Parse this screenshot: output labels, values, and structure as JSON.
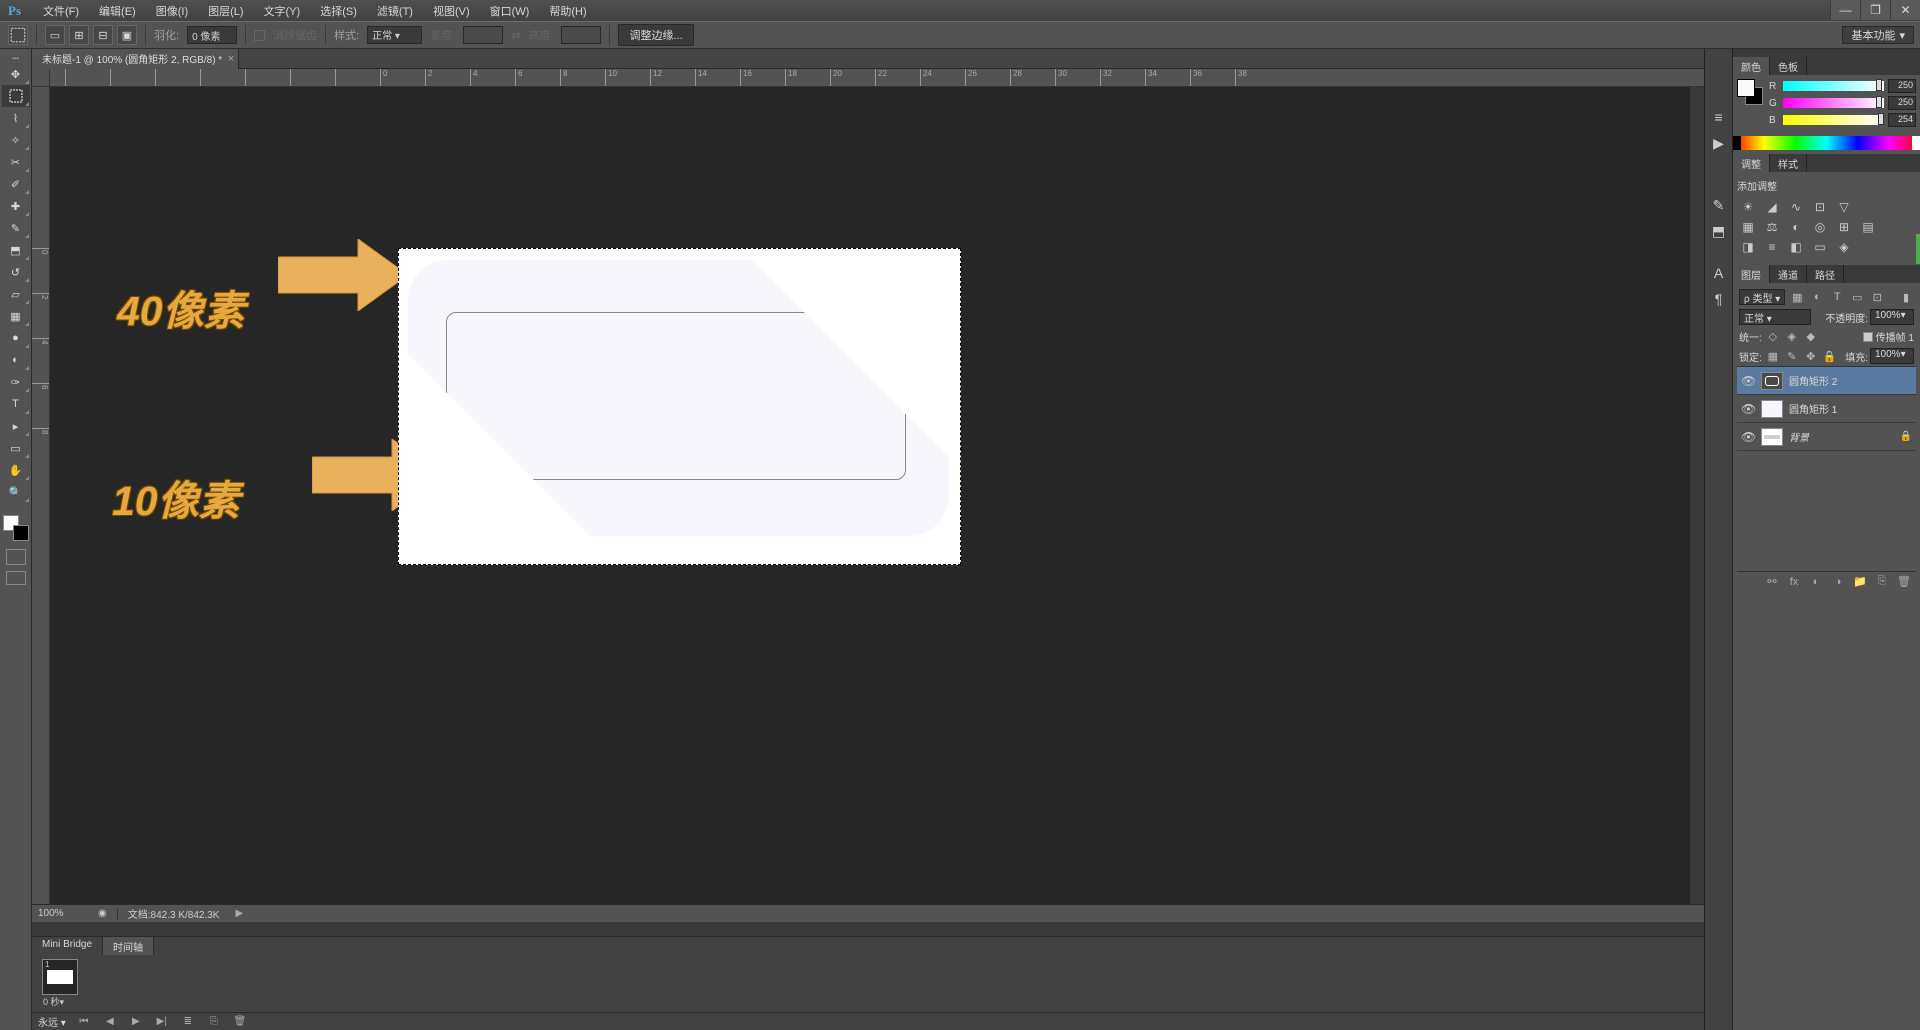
{
  "app": {
    "logo": "Ps"
  },
  "menubar": [
    "文件(F)",
    "编辑(E)",
    "图像(I)",
    "图层(L)",
    "文字(Y)",
    "选择(S)",
    "滤镜(T)",
    "视图(V)",
    "窗口(W)",
    "帮助(H)"
  ],
  "options": {
    "feather_label": "羽化:",
    "feather_value": "0 像素",
    "antialias_label": "消除锯齿",
    "style_label": "样式:",
    "style_value": "正常",
    "width_label": "宽度:",
    "height_label": "高度:",
    "refine_edge": "调整边缘...",
    "workspace": "基本功能"
  },
  "document": {
    "tab_title": "未标题-1 @ 100% (圆角矩形 2, RGB/8) *",
    "zoom": "100%",
    "doc_info": "文档:842.3 K/842.3K"
  },
  "ruler_h": [
    0,
    2,
    4,
    6,
    8,
    10,
    12,
    14,
    16,
    18,
    20,
    22,
    24,
    26,
    28,
    30,
    32,
    34,
    36,
    38
  ],
  "ruler_v": [
    0,
    2,
    4,
    6,
    8
  ],
  "annotations": {
    "top_label": "40像素",
    "bottom_label": "10像素"
  },
  "timeline": {
    "tab_minibridge": "Mini Bridge",
    "tab_timeline": "时间轴",
    "frame_num": "1",
    "frame_delay": "0 秒▾",
    "loop": "永远"
  },
  "color_panel": {
    "tab_color": "颜色",
    "tab_swatches": "色板",
    "r": {
      "label": "R",
      "value": "250"
    },
    "g": {
      "label": "G",
      "value": "250"
    },
    "b": {
      "label": "B",
      "value": "254"
    }
  },
  "adjustments": {
    "tab_adjust": "调整",
    "tab_styles": "样式",
    "add_label": "添加调整"
  },
  "layers": {
    "tab_layers": "图层",
    "tab_channels": "通道",
    "tab_paths": "路径",
    "kind_label": "ρ 类型",
    "blend": "正常",
    "opacity_label": "不透明度:",
    "opacity": "100%",
    "unify_label": "统一:",
    "propagate": "传播帧 1",
    "lock_label": "锁定:",
    "fill_label": "填充:",
    "fill": "100%",
    "items": [
      {
        "name": "圆角矩形 2"
      },
      {
        "name": "圆角矩形 1"
      },
      {
        "name": "背景"
      }
    ]
  }
}
